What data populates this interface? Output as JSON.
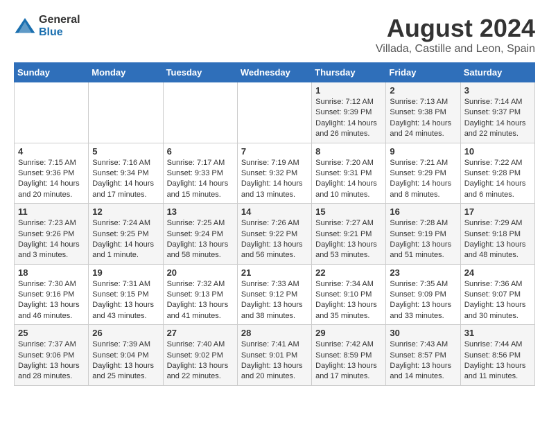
{
  "logo": {
    "general": "General",
    "blue": "Blue"
  },
  "title": {
    "month_year": "August 2024",
    "location": "Villada, Castille and Leon, Spain"
  },
  "days_of_week": [
    "Sunday",
    "Monday",
    "Tuesday",
    "Wednesday",
    "Thursday",
    "Friday",
    "Saturday"
  ],
  "weeks": [
    [
      {
        "day": "",
        "info": ""
      },
      {
        "day": "",
        "info": ""
      },
      {
        "day": "",
        "info": ""
      },
      {
        "day": "",
        "info": ""
      },
      {
        "day": "1",
        "info": "Sunrise: 7:12 AM\nSunset: 9:39 PM\nDaylight: 14 hours\nand 26 minutes."
      },
      {
        "day": "2",
        "info": "Sunrise: 7:13 AM\nSunset: 9:38 PM\nDaylight: 14 hours\nand 24 minutes."
      },
      {
        "day": "3",
        "info": "Sunrise: 7:14 AM\nSunset: 9:37 PM\nDaylight: 14 hours\nand 22 minutes."
      }
    ],
    [
      {
        "day": "4",
        "info": "Sunrise: 7:15 AM\nSunset: 9:36 PM\nDaylight: 14 hours\nand 20 minutes."
      },
      {
        "day": "5",
        "info": "Sunrise: 7:16 AM\nSunset: 9:34 PM\nDaylight: 14 hours\nand 17 minutes."
      },
      {
        "day": "6",
        "info": "Sunrise: 7:17 AM\nSunset: 9:33 PM\nDaylight: 14 hours\nand 15 minutes."
      },
      {
        "day": "7",
        "info": "Sunrise: 7:19 AM\nSunset: 9:32 PM\nDaylight: 14 hours\nand 13 minutes."
      },
      {
        "day": "8",
        "info": "Sunrise: 7:20 AM\nSunset: 9:31 PM\nDaylight: 14 hours\nand 10 minutes."
      },
      {
        "day": "9",
        "info": "Sunrise: 7:21 AM\nSunset: 9:29 PM\nDaylight: 14 hours\nand 8 minutes."
      },
      {
        "day": "10",
        "info": "Sunrise: 7:22 AM\nSunset: 9:28 PM\nDaylight: 14 hours\nand 6 minutes."
      }
    ],
    [
      {
        "day": "11",
        "info": "Sunrise: 7:23 AM\nSunset: 9:26 PM\nDaylight: 14 hours\nand 3 minutes."
      },
      {
        "day": "12",
        "info": "Sunrise: 7:24 AM\nSunset: 9:25 PM\nDaylight: 14 hours\nand 1 minute."
      },
      {
        "day": "13",
        "info": "Sunrise: 7:25 AM\nSunset: 9:24 PM\nDaylight: 13 hours\nand 58 minutes."
      },
      {
        "day": "14",
        "info": "Sunrise: 7:26 AM\nSunset: 9:22 PM\nDaylight: 13 hours\nand 56 minutes."
      },
      {
        "day": "15",
        "info": "Sunrise: 7:27 AM\nSunset: 9:21 PM\nDaylight: 13 hours\nand 53 minutes."
      },
      {
        "day": "16",
        "info": "Sunrise: 7:28 AM\nSunset: 9:19 PM\nDaylight: 13 hours\nand 51 minutes."
      },
      {
        "day": "17",
        "info": "Sunrise: 7:29 AM\nSunset: 9:18 PM\nDaylight: 13 hours\nand 48 minutes."
      }
    ],
    [
      {
        "day": "18",
        "info": "Sunrise: 7:30 AM\nSunset: 9:16 PM\nDaylight: 13 hours\nand 46 minutes."
      },
      {
        "day": "19",
        "info": "Sunrise: 7:31 AM\nSunset: 9:15 PM\nDaylight: 13 hours\nand 43 minutes."
      },
      {
        "day": "20",
        "info": "Sunrise: 7:32 AM\nSunset: 9:13 PM\nDaylight: 13 hours\nand 41 minutes."
      },
      {
        "day": "21",
        "info": "Sunrise: 7:33 AM\nSunset: 9:12 PM\nDaylight: 13 hours\nand 38 minutes."
      },
      {
        "day": "22",
        "info": "Sunrise: 7:34 AM\nSunset: 9:10 PM\nDaylight: 13 hours\nand 35 minutes."
      },
      {
        "day": "23",
        "info": "Sunrise: 7:35 AM\nSunset: 9:09 PM\nDaylight: 13 hours\nand 33 minutes."
      },
      {
        "day": "24",
        "info": "Sunrise: 7:36 AM\nSunset: 9:07 PM\nDaylight: 13 hours\nand 30 minutes."
      }
    ],
    [
      {
        "day": "25",
        "info": "Sunrise: 7:37 AM\nSunset: 9:06 PM\nDaylight: 13 hours\nand 28 minutes."
      },
      {
        "day": "26",
        "info": "Sunrise: 7:39 AM\nSunset: 9:04 PM\nDaylight: 13 hours\nand 25 minutes."
      },
      {
        "day": "27",
        "info": "Sunrise: 7:40 AM\nSunset: 9:02 PM\nDaylight: 13 hours\nand 22 minutes."
      },
      {
        "day": "28",
        "info": "Sunrise: 7:41 AM\nSunset: 9:01 PM\nDaylight: 13 hours\nand 20 minutes."
      },
      {
        "day": "29",
        "info": "Sunrise: 7:42 AM\nSunset: 8:59 PM\nDaylight: 13 hours\nand 17 minutes."
      },
      {
        "day": "30",
        "info": "Sunrise: 7:43 AM\nSunset: 8:57 PM\nDaylight: 13 hours\nand 14 minutes."
      },
      {
        "day": "31",
        "info": "Sunrise: 7:44 AM\nSunset: 8:56 PM\nDaylight: 13 hours\nand 11 minutes."
      }
    ]
  ]
}
